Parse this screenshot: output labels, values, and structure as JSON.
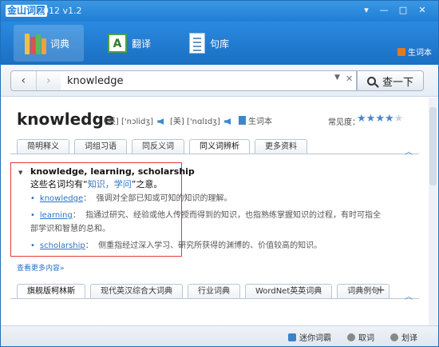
{
  "window": {
    "logo": "金山词霸",
    "version": "2012 v1.2",
    "buttons": {
      "menu": "▾",
      "minimize": "—",
      "maximize": "□",
      "close": "✕"
    }
  },
  "toolbar": {
    "tabs": [
      {
        "label": "词典",
        "icon": "books-icon"
      },
      {
        "label": "翻译",
        "icon": "translate-icon"
      },
      {
        "label": "句库",
        "icon": "sentence-icon"
      }
    ],
    "vocab_label": "生词本"
  },
  "search": {
    "back": "‹",
    "forward": "›",
    "value": "knowledge",
    "dropdown": "▼",
    "clear": "✕",
    "button_label": "查一下"
  },
  "entry": {
    "word": "knowledge",
    "phonetics": [
      {
        "region": "[英]",
        "ipa": "['nɔlidʒ]"
      },
      {
        "region": "[美]",
        "ipa": "['nɑlɪdʒ]"
      }
    ],
    "add_to_vocab": "生词本",
    "frequency_label": "常见度：",
    "frequency_stars": 4,
    "frequency_max": 5
  },
  "top_tabs": {
    "items": [
      "简明释义",
      "词组习语",
      "同反义词",
      "同义词辨析",
      "更多资料"
    ],
    "active": 3
  },
  "synonyms": {
    "heading": "knowledge, learning, scholarship",
    "sub_prefix": "这些名词均有“",
    "sub_highlight": "知识，学问",
    "sub_suffix": "”之意。",
    "items": [
      {
        "word": "knowledge",
        "sep": "：",
        "text": "强调对全部已知或可知的知识的理解。"
      },
      {
        "word": "learning",
        "sep": "：",
        "text": "指通过研究、经验或他人传授而得到的知识，也指熟练掌握知识的过程，有时可指全"
      },
      {
        "word": "",
        "sep": "",
        "text": "部学识和智慧的总和。"
      },
      {
        "word": "scholarship",
        "sep": "：",
        "text": "侧重指经过深入学习、研究所获得的渊博的、价值较高的知识。"
      }
    ],
    "more": "查看更多内容»"
  },
  "bottom_tabs": {
    "items": [
      "旗舰版柯林斯",
      "现代英汉综合大词典",
      "行业词典",
      "WordNet英英词典",
      "词典例句"
    ],
    "active": 0,
    "add": "+"
  },
  "status": {
    "mini": "迷你词霸",
    "lookup": "取词",
    "select": "划译"
  },
  "colors": {
    "titlebar": "#1f7fd6",
    "accent": "#2a73c4",
    "highlight_border": "#e23b3b"
  }
}
